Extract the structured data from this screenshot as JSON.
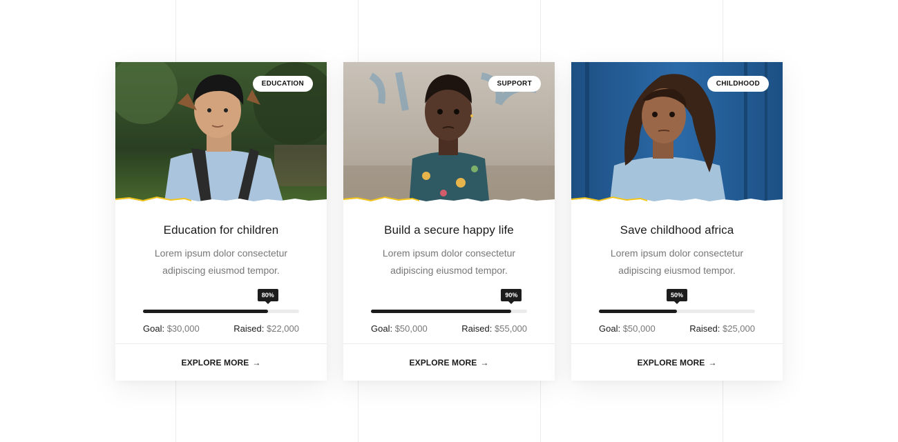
{
  "cards": [
    {
      "tag": "EDUCATION",
      "title": "Education for children",
      "description": "Lorem ipsum dolor consectetur adipiscing eiusmod tempor.",
      "progress_label": "80%",
      "progress_value": 0.8,
      "goal_label": "Goal:",
      "goal_value": "$30,000",
      "raised_label": "Raised:",
      "raised_value": "$22,000",
      "cta": "EXPLORE MORE",
      "arrow": "→"
    },
    {
      "tag": "SUPPORT",
      "title": "Build a secure happy life",
      "description": "Lorem ipsum dolor consectetur adipiscing eiusmod tempor.",
      "progress_label": "90%",
      "progress_value": 0.9,
      "goal_label": "Goal:",
      "goal_value": "$50,000",
      "raised_label": "Raised:",
      "raised_value": "$55,000",
      "cta": "EXPLORE MORE",
      "arrow": "→"
    },
    {
      "tag": "CHILDHOOD",
      "title": "Save childhood africa",
      "description": "Lorem ipsum dolor consectetur adipiscing eiusmod tempor.",
      "progress_label": "50%",
      "progress_value": 0.5,
      "goal_label": "Goal:",
      "goal_value": "$50,000",
      "raised_label": "Raised:",
      "raised_value": "$25,000",
      "cta": "EXPLORE MORE",
      "arrow": "→"
    }
  ],
  "colors": {
    "accent_yellow": "#f5c518",
    "progress_fill": "#1c1c1c",
    "progress_track": "#ebebeb"
  }
}
